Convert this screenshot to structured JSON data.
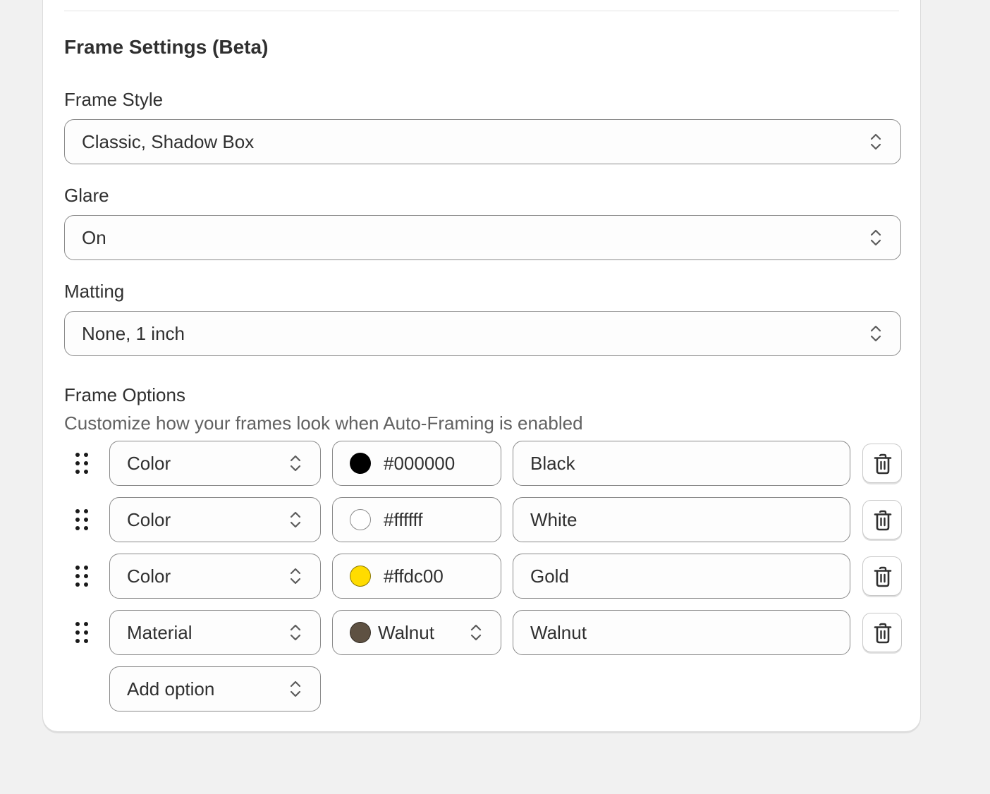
{
  "section": {
    "title": "Frame Settings (Beta)"
  },
  "frame_style": {
    "label": "Frame Style",
    "value": "Classic, Shadow Box"
  },
  "glare": {
    "label": "Glare",
    "value": "On"
  },
  "matting": {
    "label": "Matting",
    "value": "None, 1 inch"
  },
  "frame_options": {
    "title": "Frame Options",
    "description": "Customize how your frames look when Auto-Framing is enabled",
    "rows": [
      {
        "type": "Color",
        "swatch_color": "#000000",
        "value": "#000000",
        "name": "Black"
      },
      {
        "type": "Color",
        "swatch_color": "#ffffff",
        "value": "#ffffff",
        "name": "White"
      },
      {
        "type": "Color",
        "swatch_color": "#ffdc00",
        "value": "#ffdc00",
        "name": "Gold"
      },
      {
        "type": "Material",
        "swatch_color": "#5e5142",
        "value": "Walnut",
        "name": "Walnut"
      }
    ],
    "add_option_label": "Add option"
  }
}
